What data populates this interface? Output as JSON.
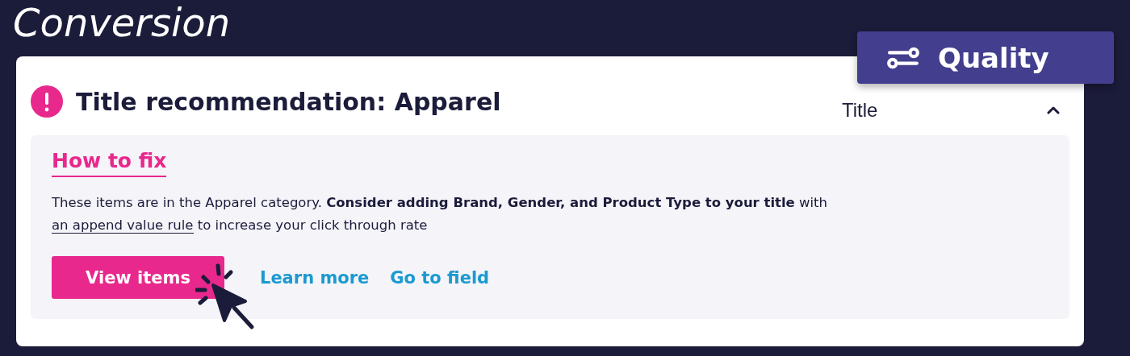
{
  "heading": "Conversion",
  "badge": {
    "label": "Quality"
  },
  "card": {
    "title": "Title recommendation: Apparel",
    "field": "Title",
    "expanded": true,
    "panel": {
      "heading": "How to fix",
      "description": {
        "text": "These items are in the Apparel category. **Consider adding Brand, Gender, and Product Type to your title** with",
        "link": "an append value rule",
        "after": " to increase your click through rate"
      },
      "actions": [
        {
          "kind": "button",
          "label": "View items"
        },
        {
          "kind": "link",
          "label": "Learn more"
        },
        {
          "kind": "link",
          "label": "Go to field"
        }
      ]
    }
  }
}
